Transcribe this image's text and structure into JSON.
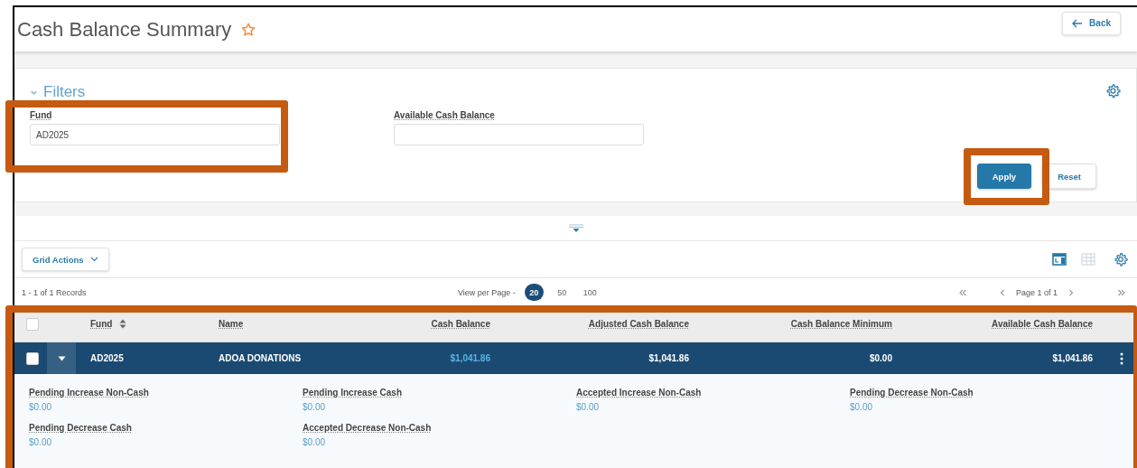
{
  "page": {
    "title": "Cash Balance Summary",
    "favorite": false,
    "back_button": "Back"
  },
  "filters": {
    "title": "Filters",
    "expanded": true,
    "fields": [
      {
        "label": "Fund",
        "value": "AD2025"
      },
      {
        "label": "Available Cash Balance"
      }
    ],
    "buttons": [
      {
        "label": "Apply",
        "kind": "primary"
      },
      {
        "label": "Reset",
        "kind": "secondary"
      }
    ]
  },
  "grid": {
    "actions_button": "Grid Actions",
    "views": [
      {
        "kind": "card",
        "selected": true
      },
      {
        "kind": "table",
        "selected": false
      }
    ],
    "records": "1 - 1 of 1 Records",
    "view_per_page_label": "View per Page -",
    "page_sizes": [
      {
        "label": "20",
        "selected": true
      },
      {
        "label": "50",
        "selected": false
      },
      {
        "label": "100",
        "selected": false
      }
    ],
    "page_info": "Page 1 of 1",
    "header_checked": false,
    "columns": [
      {
        "label": "Fund",
        "sortable": true
      },
      {
        "label": "Name",
        "sortable": false
      },
      {
        "label": "Cash Balance",
        "sortable": false
      },
      {
        "label": "Adjusted Cash Balance",
        "sortable": false
      },
      {
        "label": "Cash Balance Minimum",
        "sortable": false
      },
      {
        "label": "Available Cash Balance",
        "sortable": false
      }
    ],
    "rows": [
      {
        "checked": false,
        "expanded": true,
        "cells": [
          {
            "text": "AD2025",
            "kind": "text"
          },
          {
            "text": "ADOA DONATIONS",
            "kind": "text"
          },
          {
            "text": "$1,041.86",
            "kind": "link"
          },
          {
            "text": "$1,041.86",
            "kind": "text"
          },
          {
            "text": "$0.00",
            "kind": "text"
          },
          {
            "text": "$1,041.86",
            "kind": "text"
          }
        ],
        "details": [
          {
            "label": "Pending Increase Non-Cash",
            "value": "$0.00"
          },
          {
            "label": "Pending Increase Cash",
            "value": "$0.00"
          },
          {
            "label": "Accepted Increase Non-Cash",
            "value": "$0.00"
          },
          {
            "label": "Pending Decrease Non-Cash",
            "value": "$0.00"
          },
          {
            "label": "Pending Decrease Cash",
            "value": "$0.00"
          },
          {
            "label": "Accepted Decrease Non-Cash",
            "value": "$0.00"
          }
        ]
      }
    ]
  }
}
